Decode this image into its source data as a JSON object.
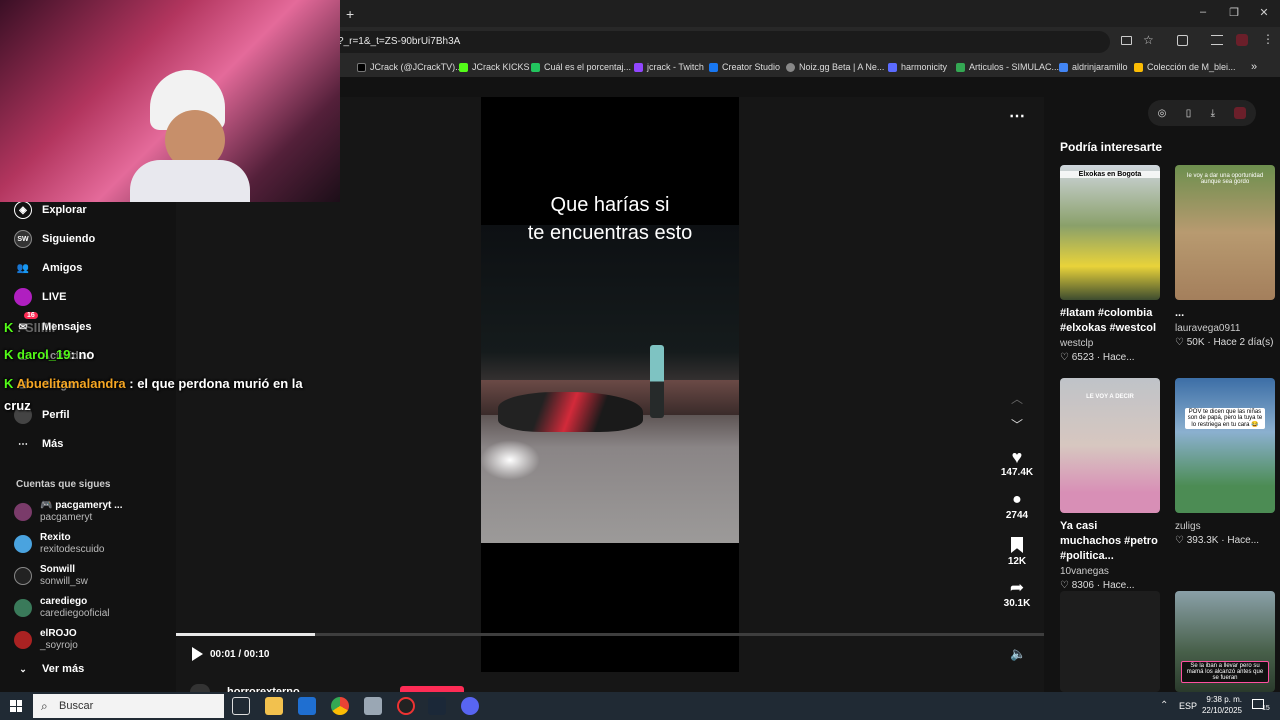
{
  "browser": {
    "url": "?_r=1&_t=ZS-90brUi7Bh3A",
    "new_tab": "+"
  },
  "bookmarks": [
    {
      "label": "JCrack (@JCrackTV)...",
      "color": "#000"
    },
    {
      "label": "JCrack KICKS",
      "color": "#53fc18"
    },
    {
      "label": "Cuál es el porcentaj...",
      "color": "#22c55e"
    },
    {
      "label": "jcrack - Twitch",
      "color": "#9146ff"
    },
    {
      "label": "Creator Studio",
      "color": "#1877f2"
    },
    {
      "label": "Noiz.gg Beta | A Ne...",
      "color": "#888"
    },
    {
      "label": "harmonicity",
      "color": "#5b6bff"
    },
    {
      "label": "Articulos - SIMULAC...",
      "color": "#34a853"
    },
    {
      "label": "aldrinjaramillo",
      "color": "#4285f4"
    },
    {
      "label": "Colección de M_blei...",
      "color": "#fbbc04"
    }
  ],
  "sidebar": {
    "nav": [
      {
        "label": "Explorar",
        "icon": "compass-icon"
      },
      {
        "label": "Siguiendo",
        "icon": "following-icon"
      },
      {
        "label": "Amigos",
        "icon": "friends-icon"
      },
      {
        "label": "LIVE",
        "icon": "live-icon"
      },
      {
        "label": "Mensajes",
        "icon": "messages-icon",
        "badge": "16"
      },
      {
        "label": "Actividad",
        "icon": "activity-icon"
      },
      {
        "label": "Cargar",
        "icon": "upload-icon"
      },
      {
        "label": "Perfil",
        "icon": "profile-icon"
      },
      {
        "label": "Más",
        "icon": "more-icon"
      }
    ],
    "following_title": "Cuentas que sigues",
    "accounts": [
      {
        "name": "🎮 pacgameryt ...",
        "user": "pacgameryt",
        "color": "#7a3b6a"
      },
      {
        "name": "Rexito",
        "user": "rexitodescuido",
        "color": "#4aa3df"
      },
      {
        "name": "Sonwill",
        "user": "sonwill_sw",
        "color": "#222"
      },
      {
        "name": "carediego",
        "user": "carediegooficial",
        "color": "#3a7a5a"
      },
      {
        "name": "elROJO",
        "user": "_soyrojo",
        "color": "#aa2222"
      }
    ],
    "see_more": "Ver más"
  },
  "video": {
    "caption_line1": "Que harías si",
    "caption_line2": "te encuentras esto",
    "likes": "147.4K",
    "comments": "2744",
    "saves": "12K",
    "shares": "30.1K",
    "time": "00:01 / 00:10",
    "progress": 0.16,
    "author": "horrorexterno"
  },
  "recs": {
    "title": "Podría interesarte",
    "cards": [
      {
        "title": "#latam #colombia #elxokas #westcol",
        "user": "westclp",
        "views": "6523",
        "time": "Hace...",
        "overlay": "Elxokas en Bogota",
        "bg": "linear-gradient(#cfd6dd,#8aa06a 45%,#e9d33a 75%,#3d4c2f)"
      },
      {
        "title": "...",
        "user": "lauravega0911",
        "views": "50K",
        "time": "Hace 2 día(s)",
        "overlay": "Ie voy a dar una oportunidad aunque sea gordo",
        "bg": "linear-gradient(#6d8f4e,#b89a70 50%,#a47f5c)"
      },
      {
        "title": "Ya casi muchachos #petro #politica...",
        "user": "10vanegas",
        "views": "8306",
        "time": "Hace...",
        "overlay": "LE VOY A DECIR",
        "bg": "linear-gradient(#bfc3c8,#d7c7c0 50%,#d88fb6 85%)"
      },
      {
        "title": "",
        "user": "zuligs",
        "views": "393.3K",
        "time": "Hace...",
        "overlay": "POV te dicen que las niñas son de papá, pero la tuya te lo restriega en tu cara 😂",
        "bg": "linear-gradient(#3c6ea6,#8bb0cf 40%,#4c8c54 80%)"
      },
      {
        "title": "",
        "user": "",
        "views": "",
        "time": "",
        "overlay": "",
        "bg": "#1d1d1d"
      },
      {
        "title": "",
        "user": "",
        "views": "",
        "time": "",
        "overlay": "Se la iban a llevar pero su mamá los alcanzó antes que se fueran",
        "bg": "linear-gradient(#8aa0a8,#48604a 60%,#2a3a2c)"
      }
    ]
  },
  "chat": {
    "line1_user": "",
    "line1_msg": ": SIIIIII",
    "line2_user": "darol_19",
    "line2_msg": ": no",
    "line3_user": "Abuelitamalandra",
    "line3_msg": ": el que perdona murió en la cruz"
  },
  "taskbar": {
    "search": "Buscar",
    "lang": "ESP",
    "time": "9:38 p. m.",
    "date": "22/10/2025",
    "notif": "15"
  }
}
